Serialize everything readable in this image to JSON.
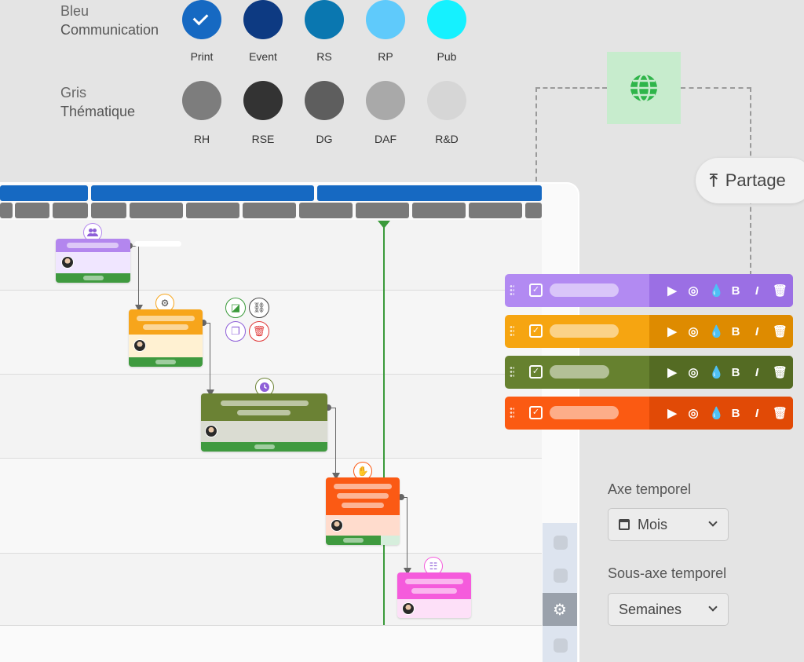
{
  "palettes": [
    {
      "name_line1": "Bleu",
      "name_line2": "Communication",
      "swatches": [
        {
          "label": "Print",
          "color": "#1669c2",
          "selected": true
        },
        {
          "label": "Event",
          "color": "#0d3a82"
        },
        {
          "label": "RS",
          "color": "#0a77b0"
        },
        {
          "label": "RP",
          "color": "#5fcafb"
        },
        {
          "label": "Pub",
          "color": "#15f1ff"
        }
      ]
    },
    {
      "name_line1": "Gris",
      "name_line2": "Thématique",
      "swatches": [
        {
          "label": "RH",
          "color": "#7d7d7d"
        },
        {
          "label": "RSE",
          "color": "#333333"
        },
        {
          "label": "DG",
          "color": "#5e5e5e"
        },
        {
          "label": "DAF",
          "color": "#a9a9a9"
        },
        {
          "label": "R&D",
          "color": "#d6d6d6"
        }
      ]
    }
  ],
  "share": {
    "label": "Partage"
  },
  "style_bars": [
    {
      "color": "#b28af2",
      "tool_color": "#9b6fe4"
    },
    {
      "color": "#f6a511",
      "tool_color": "#de8b00"
    },
    {
      "color": "#66812f",
      "tool_color": "#546b23"
    },
    {
      "color": "#fb5a12",
      "tool_color": "#e14a06"
    }
  ],
  "style_tools": [
    "play-icon",
    "hide-icon",
    "color-drop-icon",
    "bold-icon",
    "italic-icon",
    "trash-icon"
  ],
  "settings": {
    "axis_label": "Axe temporel",
    "axis_value": "Mois",
    "subaxis_label": "Sous-axe temporel",
    "subaxis_value": "Semaines"
  },
  "tasks": [
    {
      "name": "task-purple",
      "color": "#b386ee",
      "icon": "group-icon"
    },
    {
      "name": "task-orange",
      "color": "#f7a51b",
      "icon": "gear-icon"
    },
    {
      "name": "task-olive",
      "color": "#6b8234",
      "icon": "clock-icon"
    },
    {
      "name": "task-red",
      "color": "#fb5a14",
      "icon": "hand-icon"
    },
    {
      "name": "task-pink",
      "color": "#f55bdc",
      "icon": "checklist-icon"
    }
  ],
  "colors": {
    "month_bar": "#1669c2",
    "week_bar": "#7a7a7a",
    "today_line": "#3a9a3a",
    "progress": "#3f9a3f"
  }
}
